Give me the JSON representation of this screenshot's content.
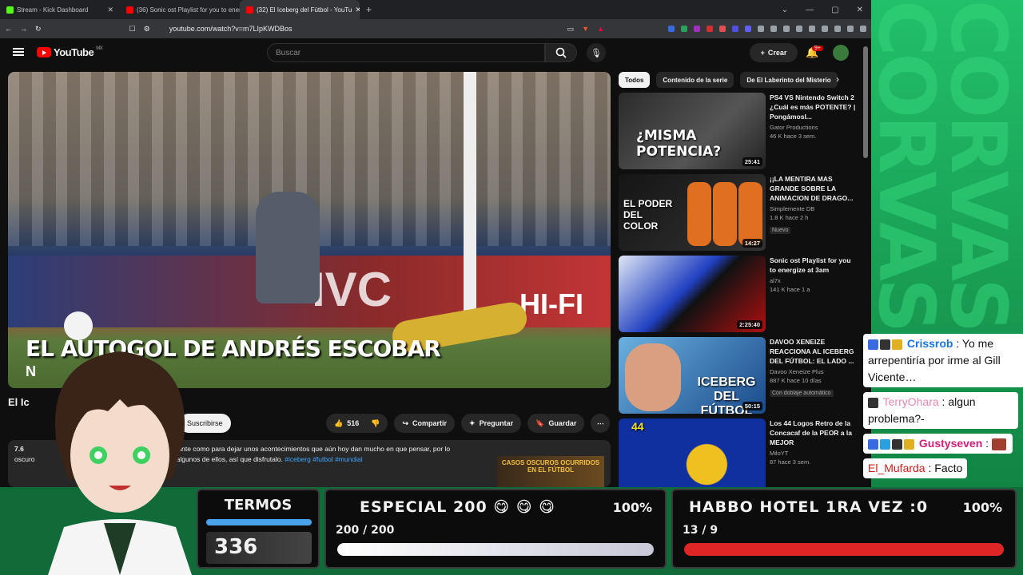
{
  "browser": {
    "tabs": [
      {
        "title": "Stream - Kick Dashboard",
        "color": "#53fc18"
      },
      {
        "title": "(36) Sonic ost Playlist for you to ener",
        "color": "#ff0000"
      },
      {
        "title": "(32) El Iceberg del Fútbol - YouTu",
        "color": "#ff0000",
        "active": true
      }
    ],
    "url": "youtube.com/watch?v=m7LIpKWDBos"
  },
  "youtube": {
    "logo_text": "YouTube",
    "region": "MX",
    "search_placeholder": "Buscar",
    "create_label": "Crear",
    "notif_count": "9+"
  },
  "video": {
    "overlay_title": "EL AUTOGOL DE ANDRÉS ESCOBAR",
    "overlay_sub": "N",
    "title_partial": "El Ic",
    "subscribe_label": "Suscribirse",
    "likes": "516",
    "share_label": "Compartir",
    "ask_label": "Preguntar",
    "save_label": "Guardar",
    "desc_views": "7.6",
    "desc_line1": "stante como para dejar unos acontecimientos que aún hoy dan mucho en que pensar, por lo",
    "desc_line2_prefix": "oscuro",
    "desc_line2_rest": "o algunos de ellos, así que disfrutalo.",
    "desc_tags": "#iceberg #futbol #mundial",
    "desc_thumb_text": "CASOS OSCUROS OCURRIDOS EN EL FÚTBOL"
  },
  "chips": [
    "Todos",
    "Contenido de la serie",
    "De El Laberinto del Misterio"
  ],
  "recommendations": [
    {
      "title": "PS4 VS Nintendo Switch 2 ¿Cuál es más POTENTE? | Pongámosl...",
      "channel": "Gator Productions",
      "meta": "46 K  hace 3 sem.",
      "duration": "25:41",
      "thumb_text": "¿MISMA POTENCIA?",
      "tag": ""
    },
    {
      "title": "¡¡LA MENTIRA MAS GRANDE SOBRE LA ANIMACION DE DRAGO...",
      "channel": "Simplemente DB",
      "meta": "1.8 K  hace 2 h",
      "duration": "14:27",
      "thumb_text": "EL PODER DEL COLOR",
      "tag": "Nuevo"
    },
    {
      "title": "Sonic ost Playlist for you to energize at 3am",
      "channel": "al7x",
      "meta": "141 K  hace 1 a",
      "duration": "2:25:40",
      "thumb_text": "",
      "tag": ""
    },
    {
      "title": "DAVOO XENEIZE REACCIONA AL ICEBERG DEL FÚTBOL: EL LADO ...",
      "channel": "Davoo Xeneize Plus",
      "meta": "887 K  hace 10 días",
      "duration": "50:15",
      "thumb_text": "ICEBERG DEL FÚTBOL",
      "tag": "Con doblaje automático"
    },
    {
      "title": "Los 44 Logos Retro de la Concacaf de la PEOR a la MEJOR",
      "channel": "MiloYT",
      "meta": "87  hace 3 sem.",
      "duration": "",
      "thumb_text": "44",
      "tag": ""
    }
  ],
  "chat": [
    {
      "user": "Crissrob",
      "user_color": "#1a73e8",
      "text": " : Yo me arrepentiría por irme al Gill Vicente…"
    },
    {
      "user": "TerryOhara",
      "user_color": "#e88ab0",
      "text": " : algun problema?-"
    },
    {
      "user": "Gustyseven",
      "user_color": "#d0207a",
      "text": " : "
    },
    {
      "user": "El_Mufarda",
      "user_color": "#d02020",
      "text": " : Facto"
    }
  ],
  "overlay": {
    "termos": {
      "label": "TERMOS",
      "value": "336"
    },
    "goals": [
      {
        "title": "ESPECIAL 200",
        "percent": "100%",
        "count": "200 / 200",
        "progress": 1.0,
        "fill": "#f0f0f0"
      },
      {
        "title": "HABBO HOTEL 1RA VEZ :0",
        "percent": "100%",
        "count": "13 / 9",
        "progress": 1.0,
        "fill": "#e02525"
      }
    ]
  },
  "stream_bg_text": "CORVASE"
}
